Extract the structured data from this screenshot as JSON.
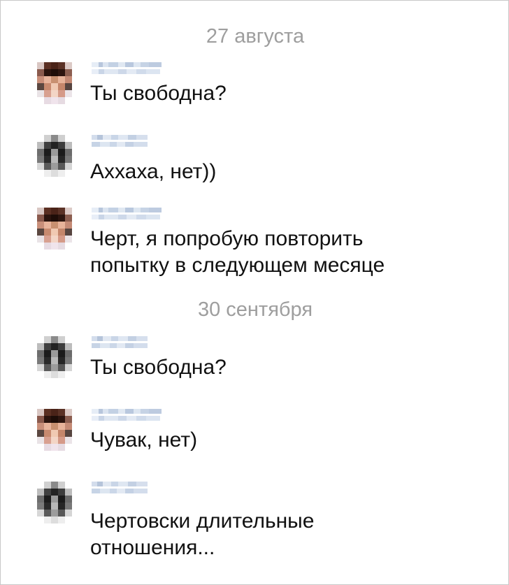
{
  "dates": [
    "27 августа",
    "30 сентября"
  ],
  "messages": [
    {
      "author": "a",
      "text": "Ты свободна?"
    },
    {
      "author": "b",
      "text": "Аххаха, нет))"
    },
    {
      "author": "a",
      "text": "Черт, я попробую повторить\nпопытку в следующем месяце"
    },
    {
      "author": "b",
      "text": "Ты свободна?"
    },
    {
      "author": "a",
      "text": "Чувак, нет)"
    },
    {
      "author": "b",
      "text": "Чертовски длительные\nотношения..."
    }
  ],
  "colors": {
    "date": "#9e9e9e",
    "text": "#111111",
    "name_blur": "#b9c8de",
    "border": "#c8c8c8"
  }
}
